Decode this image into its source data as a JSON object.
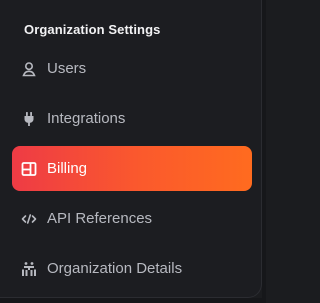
{
  "section": {
    "title": "Organization Settings"
  },
  "menu": {
    "items": [
      {
        "label": "Users",
        "icon": "user-icon",
        "active": false
      },
      {
        "label": "Integrations",
        "icon": "plug-icon",
        "active": false
      },
      {
        "label": "Billing",
        "icon": "billing-icon",
        "active": true
      },
      {
        "label": "API References",
        "icon": "code-icon",
        "active": false
      },
      {
        "label": "Organization Details",
        "icon": "organization-icon",
        "active": false
      }
    ]
  },
  "colors": {
    "background": "#1c1d21",
    "text": "#b7b9c0",
    "title": "#f2f2f4",
    "accent_start": "#ee3b45",
    "accent_end": "#ff6b1f"
  }
}
